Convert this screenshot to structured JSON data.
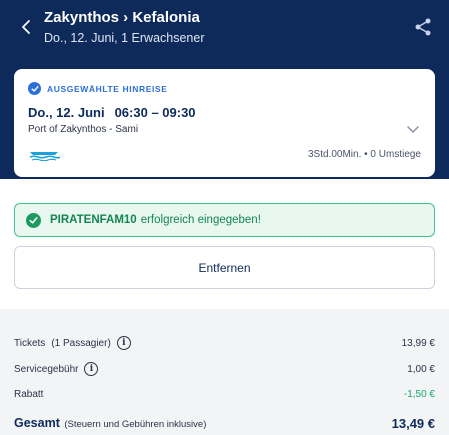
{
  "header": {
    "title": "Zakynthos › Kefalonia",
    "subtitle": "Do., 12. Juni, 1 Erwachsener",
    "back_icon": "chevron-left-icon",
    "share_icon": "share-icon",
    "background_color": "#0d2a5b"
  },
  "trip_card": {
    "selected_label": "AUSGEWÄHLTE HINREISE",
    "date": "Do., 12. Juni",
    "time": "06:30 – 09:30",
    "route": "Port of Zakynthos  -  Sami",
    "duration": "3Std.00Min. • 0 Umstiege",
    "transport_icon": "ferry-icon",
    "expand_icon": "chevron-down-icon"
  },
  "promo": {
    "code": "PIRATENFAM10",
    "message": "erfolgreich eingegeben!",
    "accent_color": "#15854f"
  },
  "remove_button": {
    "label": "Entfernen"
  },
  "price_summary": {
    "tickets_label": "Tickets",
    "tickets_note": "(1 Passagier)",
    "tickets_value": "13,99 €",
    "service_fee_label": "Servicegebühr",
    "service_fee_value": "1,00 €",
    "discount_label": "Rabatt",
    "discount_value": "-1,50 €",
    "discount_color": "#1aa86a",
    "total_label": "Gesamt",
    "total_note": "(Steuern und Gebühren inklusive)",
    "total_value": "13,49 €"
  }
}
